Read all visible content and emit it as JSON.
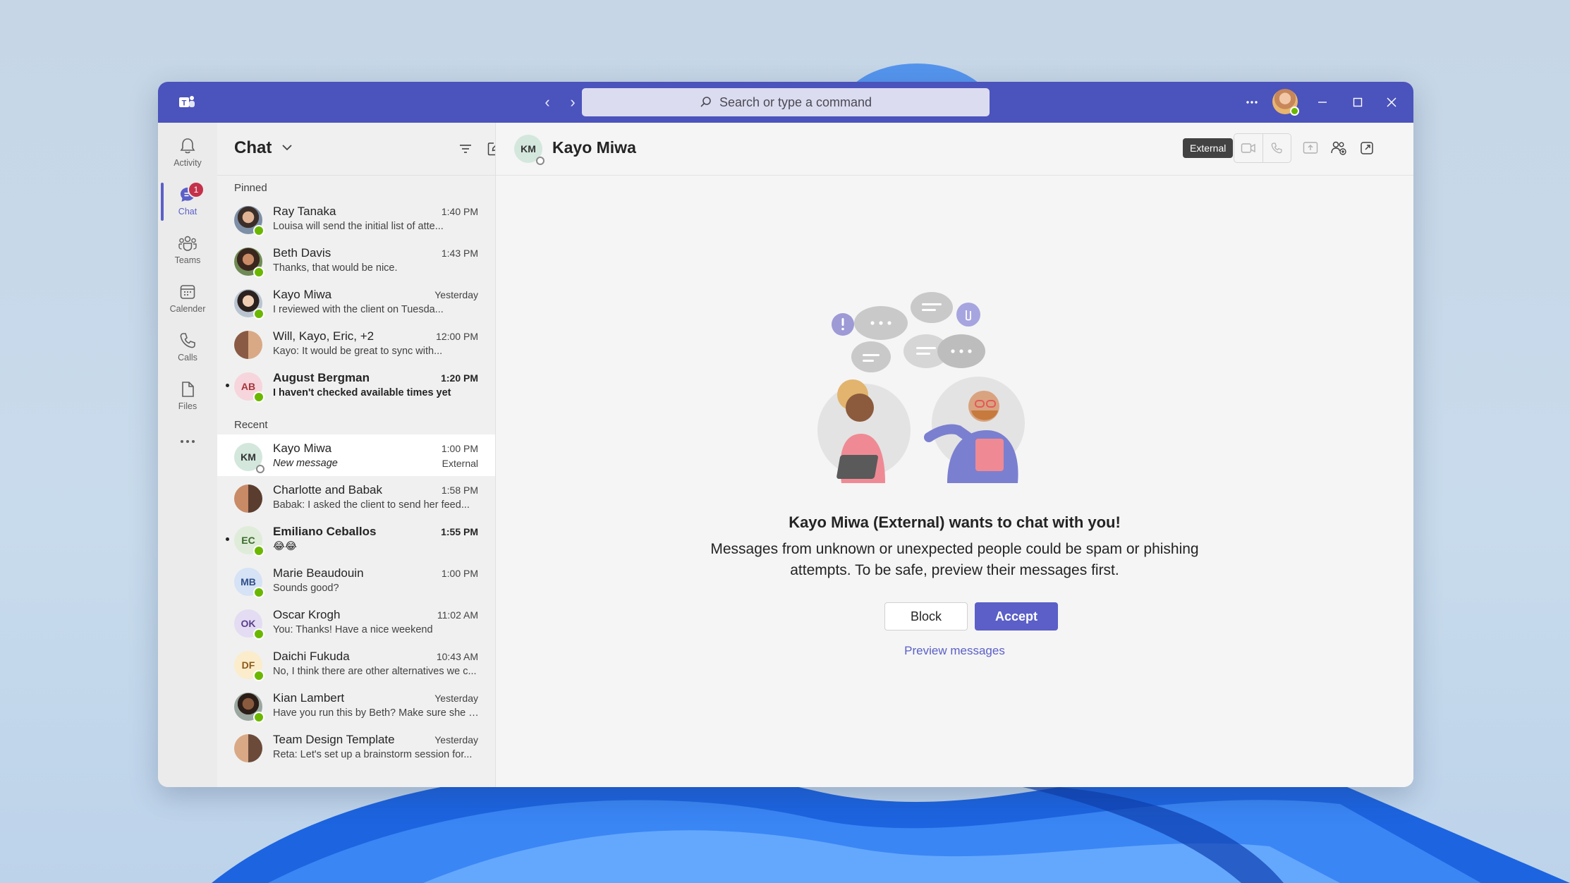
{
  "titlebar": {
    "search_placeholder": "Search or type a command",
    "more_icon": "more-horizontal-icon",
    "accent": "#4b53bc"
  },
  "rail": {
    "items": [
      {
        "label": "Activity",
        "icon": "bell-icon"
      },
      {
        "label": "Chat",
        "icon": "chat-icon",
        "badge": "1"
      },
      {
        "label": "Teams",
        "icon": "teams-icon"
      },
      {
        "label": "Calender",
        "icon": "calendar-icon"
      },
      {
        "label": "Calls",
        "icon": "phone-icon"
      },
      {
        "label": "Files",
        "icon": "file-icon"
      }
    ]
  },
  "chatlist": {
    "title": "Chat",
    "pinned_label": "Pinned",
    "recent_label": "Recent",
    "pinned": [
      {
        "name": "Ray Tanaka",
        "time": "1:40 PM",
        "preview": "Louisa will send the initial list of atte..."
      },
      {
        "name": "Beth Davis",
        "time": "1:43 PM",
        "preview": "Thanks, that would be nice."
      },
      {
        "name": "Kayo Miwa",
        "time": "Yesterday",
        "preview": "I reviewed with the client on Tuesda..."
      },
      {
        "name": "Will, Kayo, Eric, +2",
        "time": "12:00 PM",
        "preview": "Kayo: It would be great to sync with..."
      },
      {
        "name": "August Bergman",
        "initials": "AB",
        "time": "1:20 PM",
        "preview": "I haven't checked available times yet"
      }
    ],
    "recent": [
      {
        "name": "Kayo Miwa",
        "initials": "KM",
        "time": "1:00 PM",
        "preview": "New message",
        "sub": "External"
      },
      {
        "name": "Charlotte and Babak",
        "time": "1:58 PM",
        "preview": "Babak: I asked the client to send her feed..."
      },
      {
        "name": "Emiliano Ceballos",
        "initials": "EC",
        "time": "1:55 PM",
        "preview": "😂😂"
      },
      {
        "name": "Marie Beaudouin",
        "initials": "MB",
        "time": "1:00 PM",
        "preview": "Sounds good?"
      },
      {
        "name": "Oscar Krogh",
        "initials": "OK",
        "time": "11:02 AM",
        "preview": "You: Thanks! Have a nice weekend"
      },
      {
        "name": "Daichi Fukuda",
        "initials": "DF",
        "time": "10:43 AM",
        "preview": "No, I think there are other alternatives we c..."
      },
      {
        "name": "Kian Lambert",
        "time": "Yesterday",
        "preview": "Have you run this by Beth? Make sure she is..."
      },
      {
        "name": "Team Design Template",
        "time": "Yesterday",
        "preview": "Reta: Let's set up a brainstorm session for..."
      }
    ]
  },
  "conversation": {
    "initials": "KM",
    "name": "Kayo Miwa",
    "external_badge": "External",
    "prompt_title": "Kayo Miwa (External) wants to chat with you!",
    "prompt_body": "Messages from unknown or unexpected people could be spam or phishing attempts. To be safe, preview their messages first.",
    "block_label": "Block",
    "accept_label": "Accept",
    "preview_link": "Preview messages"
  }
}
